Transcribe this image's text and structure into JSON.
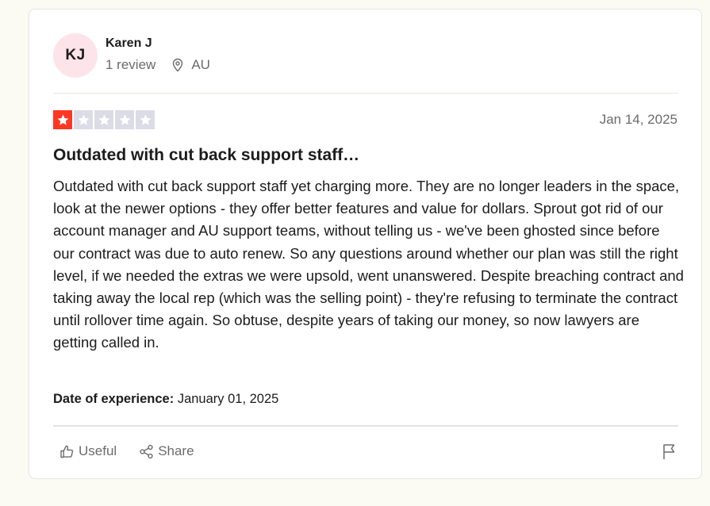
{
  "consumer": {
    "initials": "KJ",
    "name": "Karen J",
    "review_count": "1 review",
    "location": "AU"
  },
  "review": {
    "rating": 1,
    "max_rating": 5,
    "filled_star_color": "#ff3722",
    "empty_star_color": "#dcdce6",
    "date": "Jan 14, 2025",
    "title": "Outdated with cut back support staff…",
    "body": "Outdated with cut back support staff yet charging more. They are no longer leaders in the space, look at the newer options - they offer better features and value for dollars. Sprout got rid of our account manager and AU support teams, without telling us - we've been ghosted since before our contract was due to auto renew. So any questions around whether our plan was still the right level, if we needed the extras we were upsold, went unanswered. Despite breaching contract and taking away the local rep (which was the selling point) - they're refusing to terminate the contract until rollover time again. So obtuse, despite years of taking our money, so now lawyers are getting called in.",
    "experience_label": "Date of experience:",
    "experience_date": "January 01, 2025"
  },
  "actions": {
    "useful_label": "Useful",
    "share_label": "Share",
    "useful_icon": "thumbs-up-icon",
    "share_icon": "share-icon",
    "flag_icon": "flag-icon"
  }
}
